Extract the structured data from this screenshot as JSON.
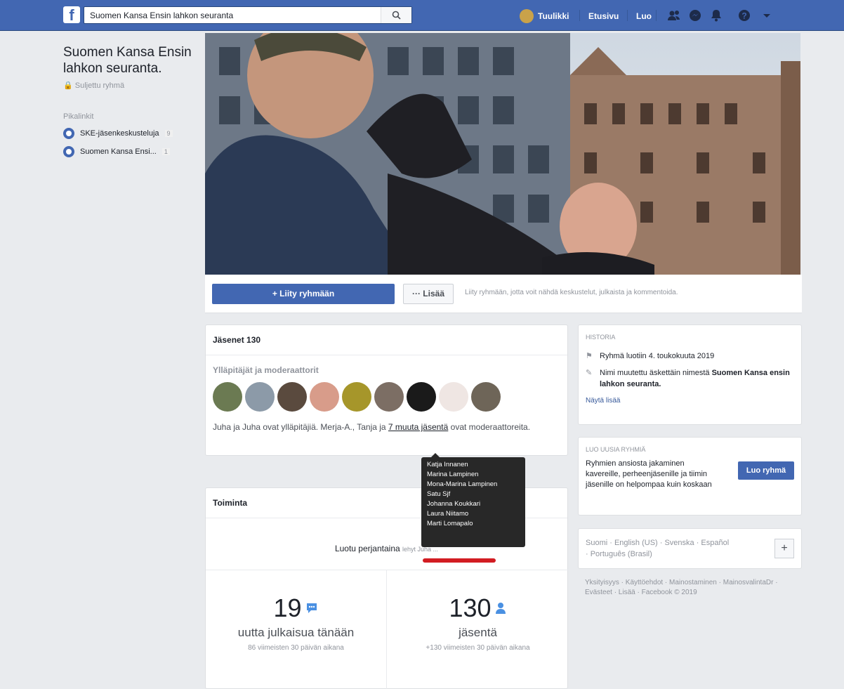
{
  "search": {
    "value": "Suomen Kansa Ensin lahkon seuranta"
  },
  "nav": {
    "user": "Tuulikki",
    "home": "Etusivu",
    "create": "Luo"
  },
  "group": {
    "name": "Suomen Kansa Ensin lahkon seuranta.",
    "privacy": "Suljettu ryhmä",
    "shortcuts_title": "Pikalinkit",
    "shortcuts": [
      {
        "label": "SKE-jäsenkeskusteluja",
        "count": "9"
      },
      {
        "label": "Suomen Kansa Ensi...",
        "count": "1"
      }
    ]
  },
  "cover_bar": {
    "join": "+ Liity ryhmään",
    "more": "··· Lisää",
    "hint": "Liity ryhmään, jotta voit nähdä keskustelut, julkaista ja kommentoida."
  },
  "members": {
    "title": "Jäsenet 130",
    "admins_title": "Ylläpitäjät ja moderaattorit",
    "mod_text_a": "Juha ja Juha ovat ylläpitäjiä. Merja-A., Tanja ja ",
    "mod_link": "7 muuta jäsentä",
    "mod_text_b": " ovat moderaattoreita.",
    "tooltip": [
      "Katja Innanen",
      "Marina Lampinen",
      "Mona-Marina Lampinen",
      "Satu Sjf",
      "Johanna Koukkari",
      "Laura Niitamo",
      "Marti Lomapalo"
    ]
  },
  "activity": {
    "title": "Toiminta",
    "created_a": "Luotu perjantaina",
    "created_b": "lehyt Juha ...",
    "posts_num": "19",
    "posts_label": "uutta julkaisua tänään",
    "posts_sub": "86 viimeisten 30 päivän aikana",
    "members_num": "130",
    "members_label": "jäsentä",
    "members_sub": "+130 viimeisten 30 päivän aikana"
  },
  "history": {
    "title": "Historia",
    "row1": "Ryhmä luotiin 4. toukokuuta 2019",
    "row2_a": "Nimi muutettu äskettäin nimestä ",
    "row2_b": "Suomen Kansa ensin lahkon seuranta.",
    "more": "Näytä lisää"
  },
  "create_group": {
    "title": "Luo uusia ryhmiä",
    "text": "Ryhmien ansiosta jakaminen kavereille, perheenjäsenille ja tiimin jäsenille on helpompaa kuin koskaan",
    "button": "Luo ryhmä"
  },
  "languages": {
    "text": "Suomi · English (US) · Svenska · Español · Português (Brasil)",
    "add": "+"
  },
  "footer": "Yksityisyys · Käyttöehdot · Mainostaminen · MainosvalintaDr · Evästeet · Lisää · Facebook © 2019",
  "colors": {
    "brand": "#4267b2",
    "bg": "#e9ebee",
    "annotation": "#d21c22"
  }
}
